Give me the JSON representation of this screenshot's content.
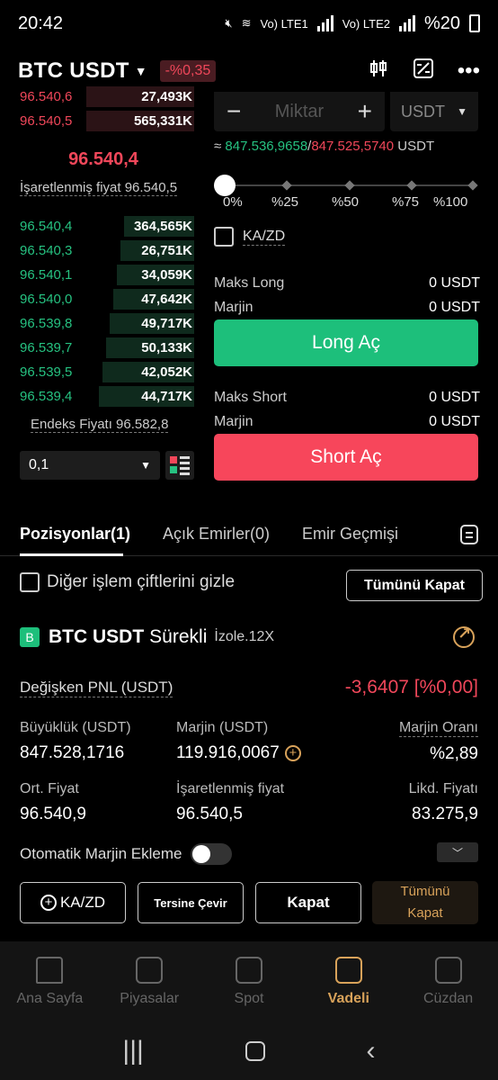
{
  "status_bar": {
    "time": "20:42",
    "net1": "Vo) LTE1",
    "net2": "Vo) LTE2",
    "battery": "%20"
  },
  "header": {
    "pair": "BTC USDT",
    "change": "-%0,35"
  },
  "orderbook": {
    "asks": [
      {
        "price": "96.540,6",
        "qty": "27,493K"
      },
      {
        "price": "96.540,5",
        "qty": "565,331K"
      }
    ],
    "last_price": "96.540,4",
    "mark_price_label": "İşaretlenmiş fiyat 96.540,5",
    "bids": [
      {
        "price": "96.540,4",
        "qty": "364,565K"
      },
      {
        "price": "96.540,3",
        "qty": "26,751K"
      },
      {
        "price": "96.540,1",
        "qty": "34,059K"
      },
      {
        "price": "96.540,0",
        "qty": "47,642K"
      },
      {
        "price": "96.539,8",
        "qty": "49,717K"
      },
      {
        "price": "96.539,7",
        "qty": "50,133K"
      },
      {
        "price": "96.539,5",
        "qty": "42,052K"
      },
      {
        "price": "96.539,4",
        "qty": "44,717K"
      }
    ],
    "index_price": "Endeks Fiyatı 96.582,8",
    "precision": "0,1"
  },
  "form": {
    "amount_placeholder": "Miktar",
    "minus": "−",
    "plus": "+",
    "unit": "USDT",
    "approx_prefix": "≈ ",
    "approx_buy": "847.536,9658",
    "approx_sep": "/",
    "approx_sell": "847.525,5740",
    "approx_unit": " USDT",
    "slider_labels": [
      "0%",
      "%25",
      "%50",
      "%75",
      "%100"
    ],
    "kazd": "KA/ZD",
    "max_long_label": "Maks Long",
    "max_long_value": "0 USDT",
    "margin_label": "Marjin",
    "margin_long_value": "0 USDT",
    "long_btn": "Long Aç",
    "max_short_label": "Maks Short",
    "max_short_value": "0 USDT",
    "margin_short_value": "0 USDT",
    "short_btn": "Short Aç"
  },
  "tabs": [
    "Pozisyonlar(1)",
    "Açık Emirler(0)",
    "Emir Geçmişi"
  ],
  "positions": {
    "hide_label": "Diğer işlem çiftlerini gizle",
    "close_all": "Tümünü Kapat",
    "badge": "B",
    "symbol": "BTC USDT",
    "kind": "Sürekli",
    "leverage": "İzole.12X",
    "pnl_label": "Değişken PNL (USDT)",
    "pnl_value": "-3,6407 [%0,00]",
    "size_label": "Büyüklük (USDT)",
    "size_value": "847.528,1716",
    "margin_label": "Marjin (USDT)",
    "margin_value": "119.916,0067",
    "margin_ratio_label": "Marjin Oranı",
    "margin_ratio_value": "%2,89",
    "avg_label": "Ort. Fiyat",
    "avg_value": "96.540,9",
    "mark_label": "İşaretlenmiş fiyat",
    "mark_value": "96.540,5",
    "liq_label": "Likd. Fiyatı",
    "liq_value": "83.275,9",
    "auto_margin": "Otomatik Marjin Ekleme",
    "btn_kazd": "KA/ZD",
    "btn_reverse": "Tersine Çevir",
    "btn_close": "Kapat",
    "btn_close_all_1": "Tümünü",
    "btn_close_all_2": "Kapat"
  },
  "bottom_nav": [
    "Ana Sayfa",
    "Piyasalar",
    "Spot",
    "Vadeli",
    "Cüzdan"
  ],
  "colors": {
    "green": "#26c281",
    "red": "#f0475a",
    "gold": "#d8a25a",
    "long_btn": "#1dbf7b",
    "short_btn": "#f7465b"
  }
}
